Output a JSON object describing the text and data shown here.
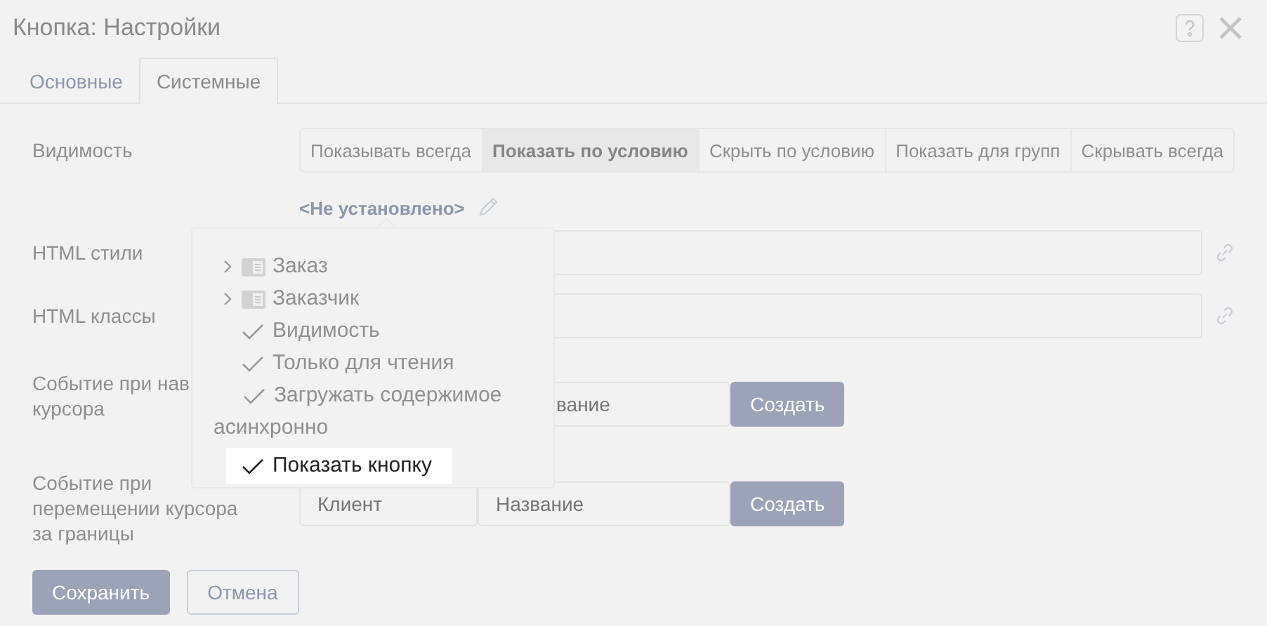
{
  "window": {
    "title": "Кнопка: Настройки"
  },
  "tabs": [
    {
      "label": "Основные",
      "selected": false
    },
    {
      "label": "Системные",
      "selected": true
    }
  ],
  "visibility": {
    "label": "Видимость",
    "options": [
      {
        "label": "Показывать всегда",
        "selected": false
      },
      {
        "label": "Показать по условию",
        "selected": true
      },
      {
        "label": "Скрыть по условию",
        "selected": false
      },
      {
        "label": "Показать для групп",
        "selected": false
      },
      {
        "label": "Скрывать всегда",
        "selected": false
      }
    ],
    "condition": "<Не установлено>"
  },
  "fields": [
    {
      "label": "HTML стили"
    },
    {
      "label": "HTML классы"
    }
  ],
  "events": [
    {
      "label_lines": [
        "Событие при нав",
        "курсора"
      ],
      "name_placeholder": "вание",
      "button": "Создать"
    },
    {
      "label_lines": [
        "Событие при",
        "перемещении курсора",
        "за границы"
      ],
      "client_placeholder": "Клиент",
      "name_placeholder": "Название",
      "button": "Создать"
    }
  ],
  "popup": {
    "items": [
      {
        "kind": "group",
        "label": "Заказ",
        "selected": false
      },
      {
        "kind": "group",
        "label": "Заказчик",
        "selected": false
      },
      {
        "kind": "field",
        "label": "Видимость",
        "selected": false
      },
      {
        "kind": "field",
        "label": "Только для чтения",
        "selected": false
      },
      {
        "kind": "field",
        "label": "Загружать содержимое асинхронно",
        "selected": false
      },
      {
        "kind": "field",
        "label": "Показать кнопку",
        "selected": true
      }
    ]
  },
  "buttons": [
    {
      "kind": "primary",
      "label": "Сохранить"
    },
    {
      "kind": "secondary",
      "label": "Отмена"
    }
  ]
}
